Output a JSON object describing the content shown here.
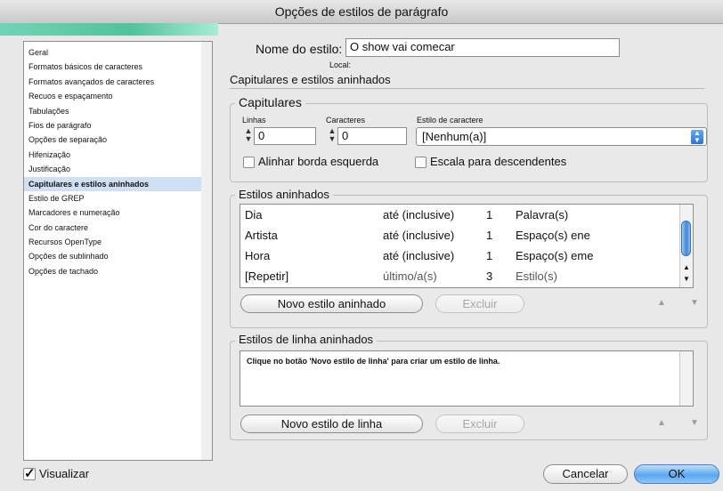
{
  "window": {
    "title": "Opções de estilos de parágrafo"
  },
  "sidebar": {
    "items": [
      {
        "label": "Geral"
      },
      {
        "label": "Formatos básicos de caracteres"
      },
      {
        "label": "Formatos avançados de caracteres"
      },
      {
        "label": "Recuos e espaçamento"
      },
      {
        "label": "Tabulações"
      },
      {
        "label": "Fios de parágrafo"
      },
      {
        "label": "Opções de separação"
      },
      {
        "label": "Hifenização"
      },
      {
        "label": "Justificação"
      },
      {
        "label": "Capitulares e estilos aninhados",
        "selected": true
      },
      {
        "label": "Estilo de GREP"
      },
      {
        "label": "Marcadores e numeração"
      },
      {
        "label": "Cor do caractere"
      },
      {
        "label": "Recursos OpenType"
      },
      {
        "label": "Opções de sublinhado"
      },
      {
        "label": "Opções de tachado"
      }
    ]
  },
  "header": {
    "style_name_label": "Nome do estilo:",
    "style_name_value": "O show vai comecar",
    "local_label": "Local:",
    "section_title": "Capitulares e estilos aninhados"
  },
  "drop_caps": {
    "title": "Capitulares",
    "lines_label": "Linhas",
    "lines_value": "0",
    "chars_label": "Caracteres",
    "chars_value": "0",
    "char_style_label": "Estilo de caractere",
    "char_style_value": "[Nenhum(a)]",
    "align_left_label": "Alinhar borda esquerda",
    "scale_desc_label": "Escala para descendentes"
  },
  "nested_styles": {
    "title": "Estilos aninhados",
    "rows": [
      {
        "style": "Dia",
        "through": "até (inclusive)",
        "count": "1",
        "unit": "Palavra(s)"
      },
      {
        "style": "Artista",
        "through": "até (inclusive)",
        "count": "1",
        "unit": "Espaço(s) ene"
      },
      {
        "style": "Hora",
        "through": "até (inclusive)",
        "count": "1",
        "unit": "Espaço(s) eme"
      },
      {
        "style": "[Repetir]",
        "through": "último/a(s)",
        "count": "3",
        "unit": "Estilo(s)"
      }
    ],
    "new_button": "Novo estilo aninhado",
    "delete_button": "Excluir"
  },
  "nested_line_styles": {
    "title": "Estilos de linha aninhados",
    "hint": "Clique no botão 'Novo estilo de linha' para criar um estilo de linha.",
    "new_button": "Novo estilo de linha",
    "delete_button": "Excluir"
  },
  "footer": {
    "preview_label": "Visualizar",
    "cancel_button": "Cancelar",
    "ok_button": "OK"
  },
  "colors": {
    "accent": "#3f86d9",
    "selection": "#cfe0f5"
  }
}
